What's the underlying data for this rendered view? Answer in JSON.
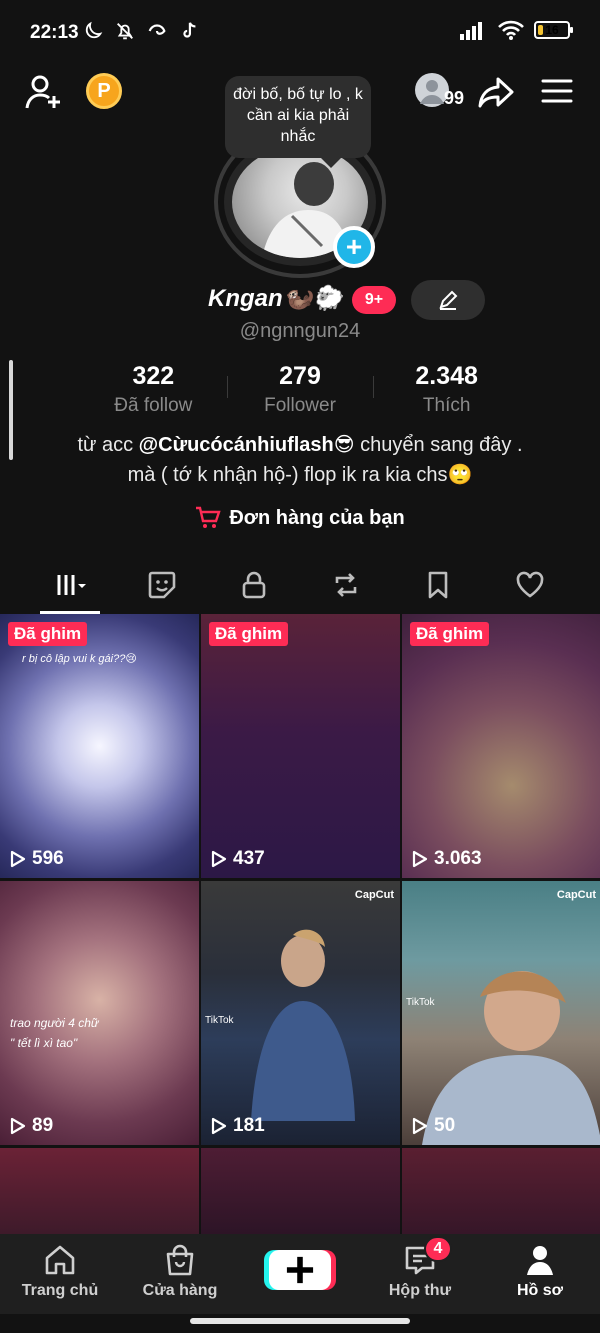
{
  "status_bar": {
    "time": "22:13",
    "battery": "16",
    "battery_level": 0.16
  },
  "header": {
    "coin_label": "P",
    "friends_count": "99"
  },
  "profile": {
    "note": "đời bố, bố tự lo , k cần ai kia phải nhắc",
    "display_name": "Kngan",
    "name_emojis": "🦦🐑",
    "badge": "9+",
    "handle": "@ngnngun24"
  },
  "stats": [
    {
      "value": "322",
      "label": "Đã follow"
    },
    {
      "value": "279",
      "label": "Follower"
    },
    {
      "value": "2.348",
      "label": "Thích"
    }
  ],
  "bio": {
    "line1_prefix": "từ acc ",
    "line1_mention": "@Cừucócánhiuflash😎",
    "line1_suffix": " chuyển sang đây .",
    "line2": "mà ( tớ k nhận hộ-) flop ik ra kia chs🙄"
  },
  "orders_label": "Đơn hàng của bạn",
  "tabs": [
    "videos",
    "stickers",
    "private",
    "reposts",
    "favorites",
    "liked"
  ],
  "videos": [
    {
      "pinned": "Đã ghim",
      "views": "596",
      "caption": "r bị cô lập vui k gái??😢"
    },
    {
      "pinned": "Đã ghim",
      "views": "437",
      "caption": ""
    },
    {
      "pinned": "Đã ghim",
      "views": "3.063",
      "caption": ""
    },
    {
      "pinned": "",
      "views": "89",
      "caption": "trao người 4 chữ\n\" tết lì xì tao\""
    },
    {
      "pinned": "",
      "views": "181",
      "caption": ""
    },
    {
      "pinned": "",
      "views": "50",
      "caption": ""
    }
  ],
  "capcut": "CapCut",
  "tiktok_mark": "TikTok",
  "bottom_nav": {
    "home": "Trang chủ",
    "shop": "Cửa hàng",
    "inbox": "Hộp thư",
    "inbox_badge": "4",
    "profile": "Hồ sơ"
  },
  "colors": {
    "accent": "#fe2c55",
    "cyan": "#25f4ee",
    "coin": "#f7a51d",
    "avatar_plus": "#20b6e8"
  }
}
